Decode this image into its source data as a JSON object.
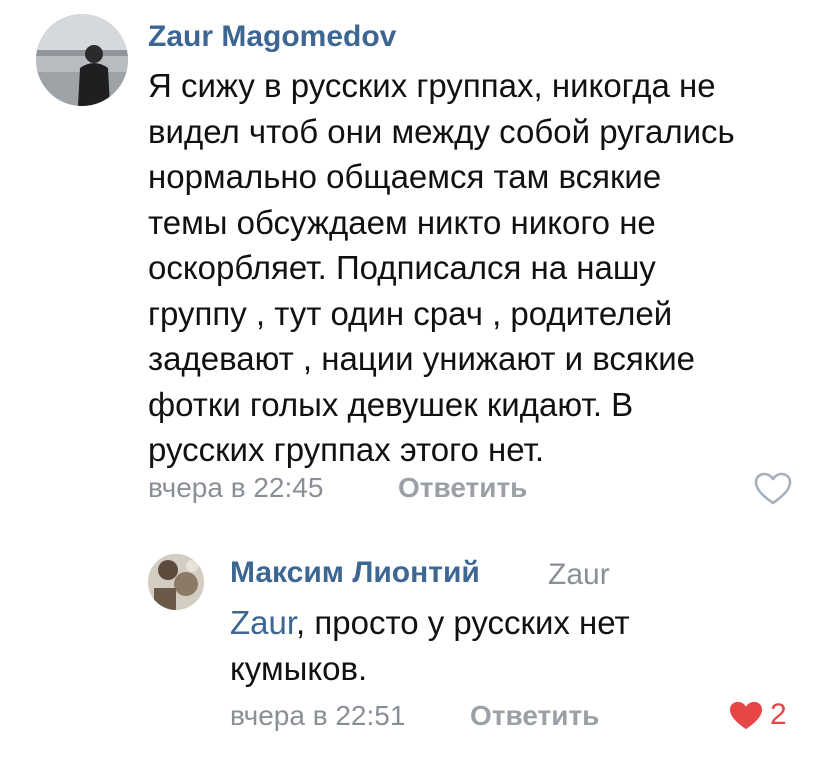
{
  "comment": {
    "author": "Zaur Magomedov",
    "text_lines": [
      "Я сижу в русских группах, никогда не",
      "видел чтоб они между собой ругались",
      "нормально общаемся там всякие",
      "темы обсуждаем никто никого не",
      "оскорбляет. Подписался на нашу",
      "группу , тут один срач , родителей",
      "задевают , нации унижают и всякие",
      "фотки голых девушек кидают. В",
      "русских группах этого нет."
    ],
    "time": "вчера в 22:45",
    "reply_label": "Ответить",
    "like_icon": "heart-outline-icon"
  },
  "reply": {
    "author": "Максим Лионтий",
    "reply_to": "Zaur",
    "mention": "Zaur",
    "text_after_mention": ", просто у русских нет",
    "text_line2": "кумыков.",
    "time": "вчера в 22:51",
    "reply_label": "Ответить",
    "like_icon": "heart-filled-icon",
    "like_count": "2"
  },
  "colors": {
    "link_blue": "#3d6693",
    "meta_gray": "#8a8f96",
    "like_red": "#e64646"
  }
}
